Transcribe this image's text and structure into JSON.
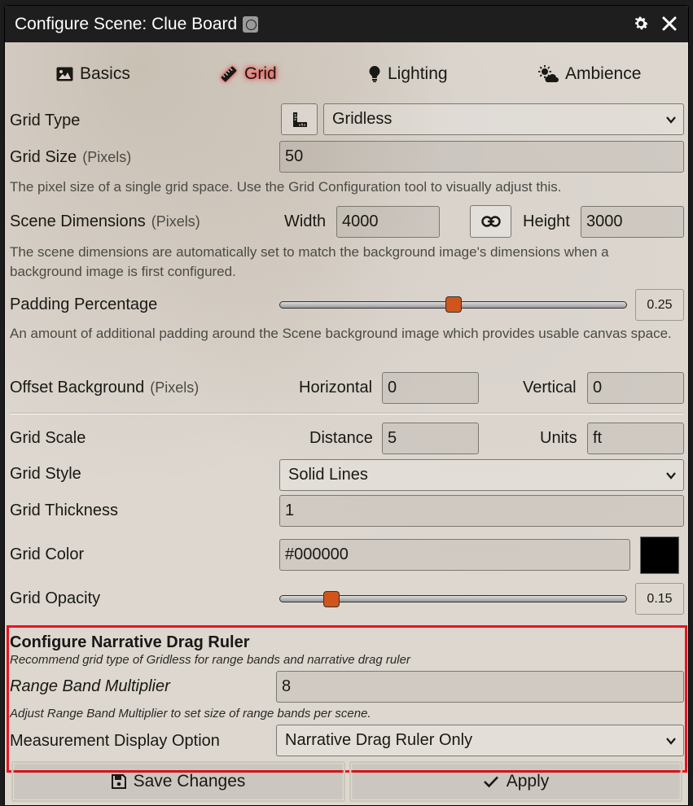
{
  "window": {
    "title": "Configure Scene: Clue Board"
  },
  "tabs": [
    {
      "label": "Basics",
      "icon": "image-icon"
    },
    {
      "label": "Grid",
      "icon": "ruler-icon",
      "active": true
    },
    {
      "label": "Lighting",
      "icon": "lightbulb-icon"
    },
    {
      "label": "Ambience",
      "icon": "cloud-sun-icon"
    }
  ],
  "grid_type": {
    "label": "Grid Type",
    "value": "Gridless"
  },
  "grid_size": {
    "label": "Grid Size",
    "units": "(Pixels)",
    "value": "50",
    "hint": "The pixel size of a single grid space. Use the Grid Configuration tool to visually adjust this."
  },
  "dimensions": {
    "label": "Scene Dimensions",
    "units": "(Pixels)",
    "width_label": "Width",
    "width": "4000",
    "height_label": "Height",
    "height": "3000",
    "hint": "The scene dimensions are automatically set to match the background image's dimensions when a background image is first configured."
  },
  "padding": {
    "label": "Padding Percentage",
    "value": "0.25",
    "fraction": 0.5,
    "hint": "An amount of additional padding around the Scene background image which provides usable canvas space."
  },
  "offset": {
    "label": "Offset Background",
    "units": "(Pixels)",
    "horizontal_label": "Horizontal",
    "horizontal": "0",
    "vertical_label": "Vertical",
    "vertical": "0"
  },
  "grid_scale": {
    "label": "Grid Scale",
    "distance_label": "Distance",
    "distance": "5",
    "units_label": "Units",
    "units": "ft"
  },
  "grid_style": {
    "label": "Grid Style",
    "value": "Solid Lines"
  },
  "grid_thickness": {
    "label": "Grid Thickness",
    "value": "1"
  },
  "grid_color": {
    "label": "Grid Color",
    "value": "#000000",
    "swatch": "#000000"
  },
  "grid_opacity": {
    "label": "Grid Opacity",
    "value": "0.15",
    "fraction": 0.15
  },
  "narrative": {
    "title": "Configure Narrative Drag Ruler",
    "hint": "Recommend grid type of Gridless for range bands and narrative drag ruler",
    "multiplier_label": "Range Band Multiplier",
    "multiplier": "8",
    "multiplier_hint": "Adjust Range Band Multiplier to set size of range bands per scene.",
    "display_label": "Measurement Display Option",
    "display_value": "Narrative Drag Ruler Only"
  },
  "buttons": {
    "save": "Save Changes",
    "apply": "Apply"
  },
  "colors": {
    "accent": "#d0551c",
    "highlight_border": "#e8141e"
  }
}
